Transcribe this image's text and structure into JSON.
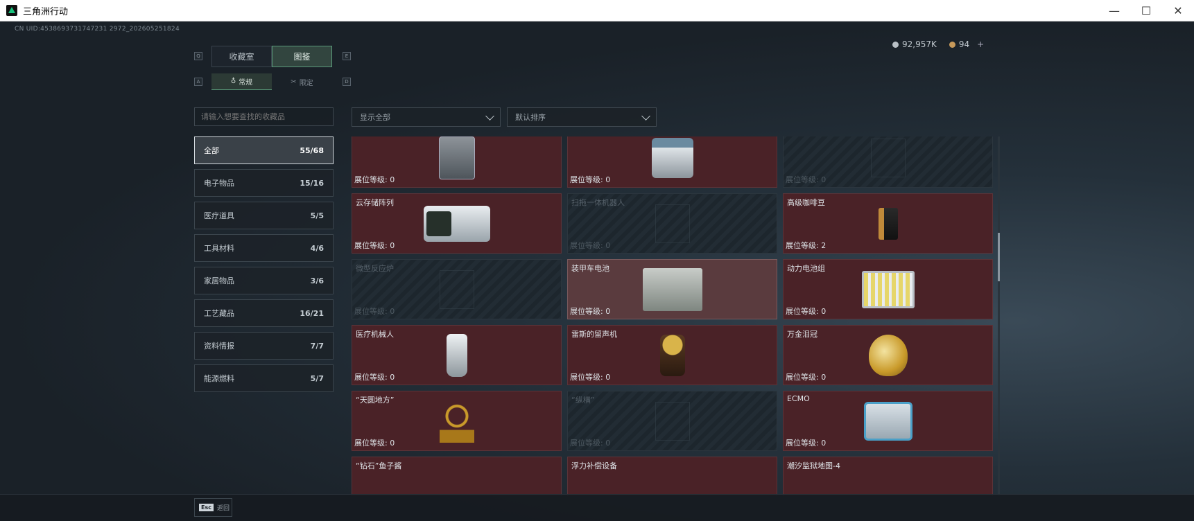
{
  "window": {
    "title": "三角洲行动",
    "controls": {
      "minimize": "—",
      "maximize": "☐",
      "close": "✕"
    }
  },
  "uid": "CN UID:4538693731747231 2972_202605251824",
  "currency": {
    "silver": "92,957K",
    "gold": "94",
    "plus": "+"
  },
  "tabs": {
    "key_left": "Q",
    "key_right": "E",
    "items": [
      "收藏室",
      "图鉴"
    ],
    "active": 1
  },
  "subtabs": {
    "key_left": "A",
    "key_right": "D",
    "items": [
      "常规",
      "限定"
    ],
    "active": 0
  },
  "search": {
    "placeholder": "请输入想要查找的收藏品"
  },
  "filters": {
    "show": "显示全部",
    "sort": "默认排序"
  },
  "categories": [
    {
      "label": "全部",
      "count": "55/68",
      "active": true
    },
    {
      "label": "电子物品",
      "count": "15/16"
    },
    {
      "label": "医疗道具",
      "count": "5/5"
    },
    {
      "label": "工具材料",
      "count": "4/6"
    },
    {
      "label": "家居物品",
      "count": "3/6"
    },
    {
      "label": "工艺藏品",
      "count": "16/21"
    },
    {
      "label": "资料情报",
      "count": "7/7"
    },
    {
      "label": "能源燃料",
      "count": "5/7"
    }
  ],
  "level_prefix": "展位等级: ",
  "items": [
    {
      "name": "",
      "level": "0",
      "locked": false,
      "art": "jerrycan"
    },
    {
      "name": "",
      "level": "0",
      "locked": false,
      "art": "pos"
    },
    {
      "name": "",
      "level": "0",
      "locked": true,
      "art": "ghost"
    },
    {
      "name": "云存储阵列",
      "level": "0",
      "locked": false,
      "art": "server"
    },
    {
      "name": "扫拖一体机器人",
      "level": "0",
      "locked": true,
      "art": "ghost"
    },
    {
      "name": "高级咖啡豆",
      "level": "2",
      "locked": false,
      "art": "coffee"
    },
    {
      "name": "微型反应炉",
      "level": "0",
      "locked": true,
      "art": "ghost"
    },
    {
      "name": "装甲车电池",
      "level": "0",
      "locked": false,
      "highlight": true,
      "art": "battery"
    },
    {
      "name": "动力电池组",
      "level": "0",
      "locked": false,
      "art": "pack"
    },
    {
      "name": "医疗机械人",
      "level": "0",
      "locked": false,
      "art": "robot"
    },
    {
      "name": "雷斯的留声机",
      "level": "0",
      "locked": false,
      "art": "phono"
    },
    {
      "name": "万金泪冠",
      "level": "0",
      "locked": false,
      "art": "egg"
    },
    {
      "name": "“天圆地方”",
      "level": "0",
      "locked": false,
      "art": "sphere"
    },
    {
      "name": "“纵横”",
      "level": "0",
      "locked": true,
      "art": "ghost"
    },
    {
      "name": "ECMO",
      "level": "0",
      "locked": false,
      "art": "ecmo"
    },
    {
      "name": "“钻石”鱼子酱",
      "level": "",
      "locked": false,
      "art": "caviar"
    },
    {
      "name": "浮力补偿设备",
      "level": "",
      "locked": false,
      "art": "float"
    },
    {
      "name": "潮汐监狱地图-4",
      "level": "",
      "locked": false,
      "art": "map"
    }
  ],
  "esc": {
    "key": "Esc",
    "label": "返回"
  },
  "colors": {
    "accent": "#5a9a7a",
    "card_owned": "#4a2227",
    "card_locked": "#1d262d"
  }
}
